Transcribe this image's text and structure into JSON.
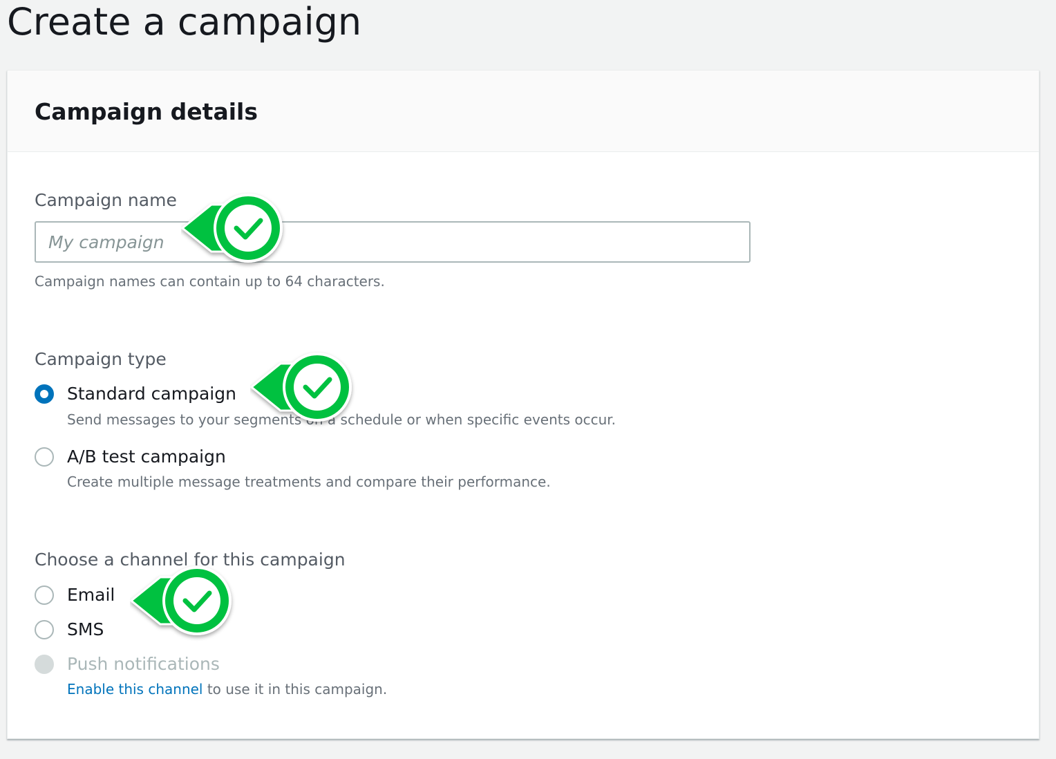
{
  "page": {
    "title": "Create a campaign"
  },
  "panel": {
    "title": "Campaign details",
    "campaign_name": {
      "label": "Campaign name",
      "placeholder": "My campaign",
      "value": "",
      "hint": "Campaign names can contain up to 64 characters."
    },
    "campaign_type": {
      "label": "Campaign type",
      "options": [
        {
          "label": "Standard campaign",
          "description": "Send messages to your segments on a schedule or when specific events occur.",
          "selected": true
        },
        {
          "label": "A/B test campaign",
          "description": "Create multiple message treatments and compare their performance.",
          "selected": false
        }
      ]
    },
    "channel": {
      "label": "Choose a channel for this campaign",
      "options": [
        {
          "label": "Email",
          "selected": false
        },
        {
          "label": "SMS",
          "selected": false
        },
        {
          "label": "Push notifications",
          "selected": false,
          "disabled": true
        }
      ],
      "push_hint_link": "Enable this channel",
      "push_hint_text": " to use it in this campaign."
    }
  },
  "annotations": {
    "marker_icon": "check-icon",
    "marker_color": "#00c13f"
  },
  "colors": {
    "accent": "#0073bb",
    "check_marker": "#00c13f",
    "background": "#f2f3f3"
  }
}
